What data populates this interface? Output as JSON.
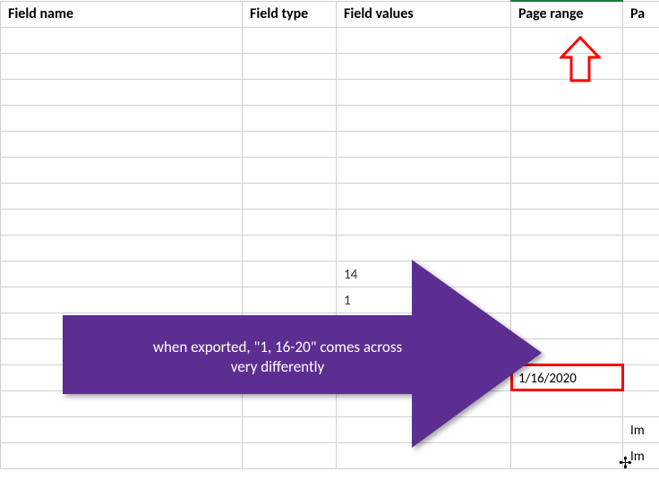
{
  "headers": {
    "field_name": "Field name",
    "field_type": "Field type",
    "field_values": "Field values",
    "page_range": "Page range",
    "last": "Pa"
  },
  "cells": {
    "mid_a": "14",
    "mid_b": "1",
    "date_cell": "1/16/2020",
    "im1": "Im",
    "im2": "Im"
  },
  "callout": {
    "text": "when exported, \"1, 16-20\" comes across very differently"
  }
}
